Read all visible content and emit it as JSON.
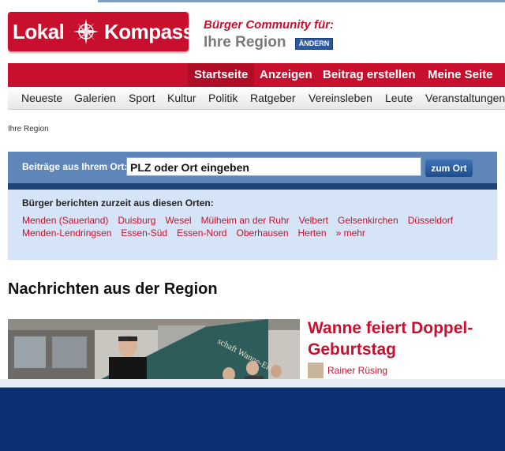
{
  "brand": {
    "word1": "Lokal",
    "word2": "Kompass",
    "logo_color": "#c8102e"
  },
  "community": {
    "tagline": "Bürger Community für:",
    "region": "Ihre Region",
    "change_button": "ÄNDERN"
  },
  "main_nav": [
    {
      "label": "Startseite"
    },
    {
      "label": "Anzeigen"
    },
    {
      "label": "Beitrag erstellen"
    },
    {
      "label": "Meine Seite"
    }
  ],
  "sub_nav": [
    {
      "label": "Neueste"
    },
    {
      "label": "Galerien"
    },
    {
      "label": "Sport"
    },
    {
      "label": "Kultur"
    },
    {
      "label": "Politik"
    },
    {
      "label": "Ratgeber"
    },
    {
      "label": "Vereinsleben"
    },
    {
      "label": "Leute"
    },
    {
      "label": "Veranstaltungen"
    }
  ],
  "breadcrumb": "Ihre Region",
  "search": {
    "label": "Beiträge aus Ihrem Ort:",
    "value": "PLZ oder Ort eingeben",
    "button": "zum Ort"
  },
  "places": {
    "heading": "Bürger berichten zurzeit aus diesen Orten:",
    "row1": [
      "Menden (Sauerland)",
      "Duisburg",
      "Wesel",
      "Mülheim an der Ruhr",
      "Velbert",
      "Gelsenkirchen",
      "Düsseldorf"
    ],
    "row2": [
      "Menden-Lendringsen",
      "Essen-Süd",
      "Essen-Nord",
      "Oberhausen",
      "Herten"
    ],
    "more": "» mehr"
  },
  "section_title": "Nachrichten aus der Region",
  "article": {
    "title": "Wanne feiert Doppel-Geburtstag",
    "author": "Rainer Rüsing",
    "banner_text": "schaft Wanne-Eickel"
  },
  "colors": {
    "red": "#c8102e",
    "blue_dark": "#1c4477",
    "blue_light": "#d5e4f7",
    "frame": "#0a2f73"
  }
}
